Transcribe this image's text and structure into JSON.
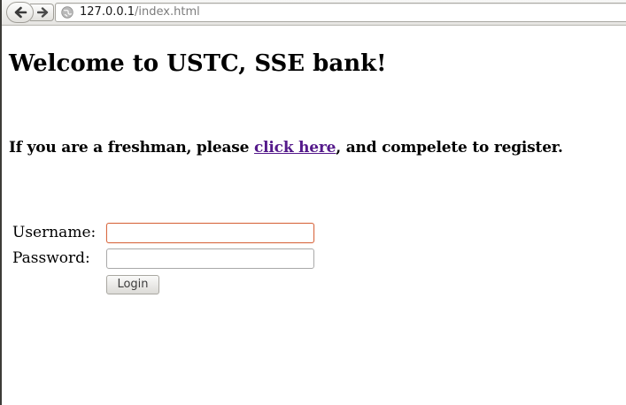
{
  "browser": {
    "url_host": "127.0.0.1",
    "url_path": "/index.html",
    "back_icon": "arrow-left-icon",
    "forward_icon": "arrow-right-icon",
    "site_icon": "globe-icon"
  },
  "page": {
    "title": "Welcome to USTC, SSE bank!",
    "register_prefix": "If you are a freshman, please ",
    "register_link": "click here",
    "register_suffix": ", and compelete to register."
  },
  "login_form": {
    "username_label": "Username:",
    "username_value": "",
    "password_label": "Password:",
    "password_value": "",
    "login_button": "Login"
  },
  "colors": {
    "visited_link": "#551a8b",
    "focused_input_border": "#d86a43"
  }
}
